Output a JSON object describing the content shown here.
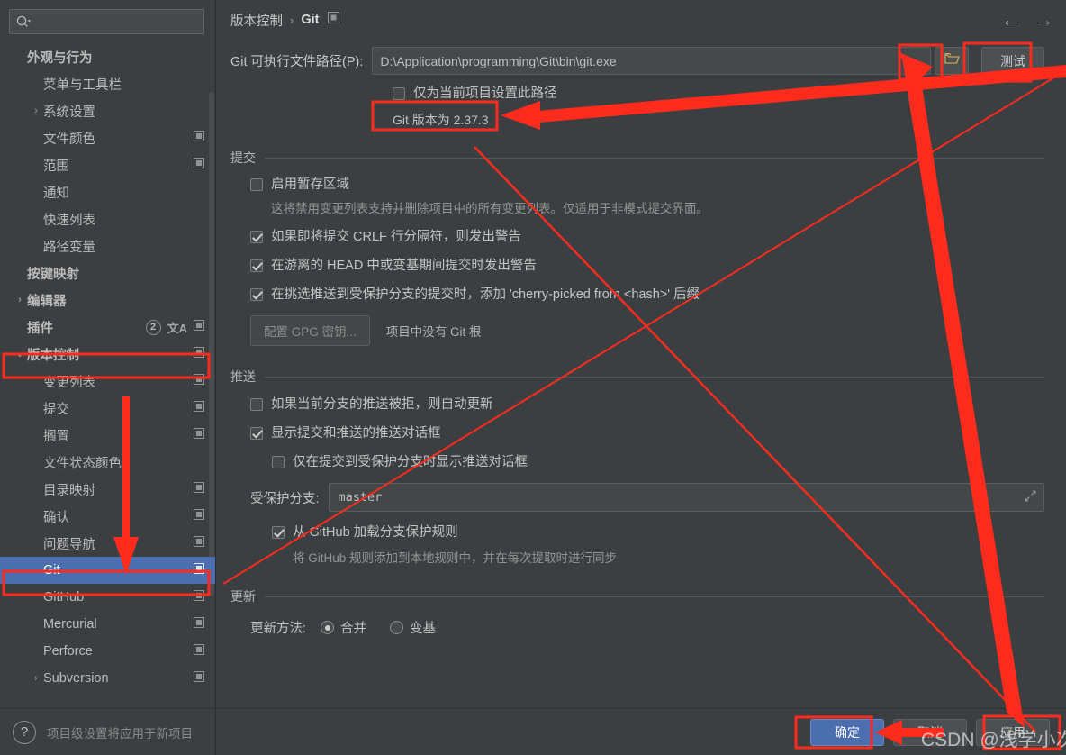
{
  "search": {
    "placeholder": "",
    "icon": "search-icon"
  },
  "sidebar": {
    "items": [
      {
        "label": "外观与行为",
        "level": 0,
        "bold": true,
        "chevron": "",
        "copy": false
      },
      {
        "label": "菜单与工具栏",
        "level": 1,
        "bold": false,
        "chevron": "",
        "copy": false
      },
      {
        "label": "系统设置",
        "level": 1,
        "bold": false,
        "chevron": "›",
        "copy": false
      },
      {
        "label": "文件颜色",
        "level": 1,
        "bold": false,
        "chevron": "",
        "copy": true
      },
      {
        "label": "范围",
        "level": 1,
        "bold": false,
        "chevron": "",
        "copy": true
      },
      {
        "label": "通知",
        "level": 1,
        "bold": false,
        "chevron": "",
        "copy": false
      },
      {
        "label": "快速列表",
        "level": 1,
        "bold": false,
        "chevron": "",
        "copy": false
      },
      {
        "label": "路径变量",
        "level": 1,
        "bold": false,
        "chevron": "",
        "copy": false
      },
      {
        "label": "按键映射",
        "level": 0,
        "bold": true,
        "chevron": "",
        "copy": false
      },
      {
        "label": "编辑器",
        "level": 0,
        "bold": true,
        "chevron": "›",
        "copy": false
      },
      {
        "label": "插件",
        "level": 0,
        "bold": true,
        "chevron": "",
        "copy": true,
        "badge": "2",
        "translate": true
      },
      {
        "label": "版本控制",
        "level": 0,
        "bold": true,
        "chevron": "⌄",
        "copy": true,
        "highlight_box": true
      },
      {
        "label": "变更列表",
        "level": 1,
        "bold": false,
        "chevron": "",
        "copy": true
      },
      {
        "label": "提交",
        "level": 1,
        "bold": false,
        "chevron": "",
        "copy": true
      },
      {
        "label": "搁置",
        "level": 1,
        "bold": false,
        "chevron": "",
        "copy": true
      },
      {
        "label": "文件状态颜色",
        "level": 1,
        "bold": false,
        "chevron": "",
        "copy": false
      },
      {
        "label": "目录映射",
        "level": 1,
        "bold": false,
        "chevron": "",
        "copy": true
      },
      {
        "label": "确认",
        "level": 1,
        "bold": false,
        "chevron": "",
        "copy": true
      },
      {
        "label": "问题导航",
        "level": 1,
        "bold": false,
        "chevron": "",
        "copy": true
      },
      {
        "label": "Git",
        "level": 1,
        "bold": false,
        "chevron": "",
        "copy": true,
        "selected": true,
        "highlight_box": true
      },
      {
        "label": "GitHub",
        "level": 1,
        "bold": false,
        "chevron": "",
        "copy": true
      },
      {
        "label": "Mercurial",
        "level": 1,
        "bold": false,
        "chevron": "",
        "copy": true
      },
      {
        "label": "Perforce",
        "level": 1,
        "bold": false,
        "chevron": "",
        "copy": true
      },
      {
        "label": "Subversion",
        "level": 1,
        "bold": false,
        "chevron": "›",
        "copy": true
      }
    ],
    "footer_note": "项目级设置将应用于新项目",
    "help_icon": "?"
  },
  "breadcrumb": {
    "parent": "版本控制",
    "separator": "›",
    "current": "Git",
    "copy_icon": "copy-settings-icon",
    "back_icon": "←",
    "forward_icon": "→"
  },
  "git_path": {
    "label": "Git 可执行文件路径(P):",
    "value": "D:\\Application\\programming\\Git\\bin\\git.exe",
    "browse_icon": "folder-icon",
    "test_label": "测试",
    "project_only_label": "仅为当前项目设置此路径",
    "project_only_checked": false,
    "version_text": "Git 版本为 2.37.3"
  },
  "commit": {
    "title": "提交",
    "staging_label": "启用暂存区域",
    "staging_checked": false,
    "staging_help": "这将禁用变更列表支持并删除项目中的所有变更列表。仅适用于非模式提交界面。",
    "crlf_label": "如果即将提交 CRLF 行分隔符，则发出警告",
    "crlf_checked": true,
    "detached_label": "在游离的 HEAD 中或变基期间提交时发出警告",
    "detached_checked": true,
    "cherry_label": "在挑选推送到受保护分支的提交时，添加 'cherry-picked from <hash>' 后缀",
    "cherry_checked": true,
    "gpg_button": "配置 GPG 密钥...",
    "gpg_note": "项目中没有 Git 根"
  },
  "push": {
    "title": "推送",
    "autoupdate_label": "如果当前分支的推送被拒，则自动更新",
    "autoupdate_checked": false,
    "show_dialog_label": "显示提交和推送的推送对话框",
    "show_dialog_checked": true,
    "protected_only_label": "仅在提交到受保护分支时显示推送对话框",
    "protected_only_checked": false,
    "protected_branches_label": "受保护分支:",
    "protected_branches_value": "master",
    "expand_icon": "expand-icon",
    "github_rules_label": "从 GitHub 加载分支保护规则",
    "github_rules_checked": true,
    "github_rules_help": "将 GitHub 规则添加到本地规则中，并在每次提取时进行同步"
  },
  "update": {
    "title": "更新",
    "method_label": "更新方法:",
    "merge_label": "合并",
    "merge_selected": true,
    "rebase_label": "变基",
    "rebase_selected": false
  },
  "footer_buttons": {
    "ok": "确定",
    "cancel": "取消",
    "apply": "应用"
  },
  "watermark": "CSDN @浅学小次",
  "colors": {
    "accent": "#4b6eaf",
    "annotation": "#ff2b1d",
    "background": "#3c3f41",
    "field": "#45494a"
  }
}
